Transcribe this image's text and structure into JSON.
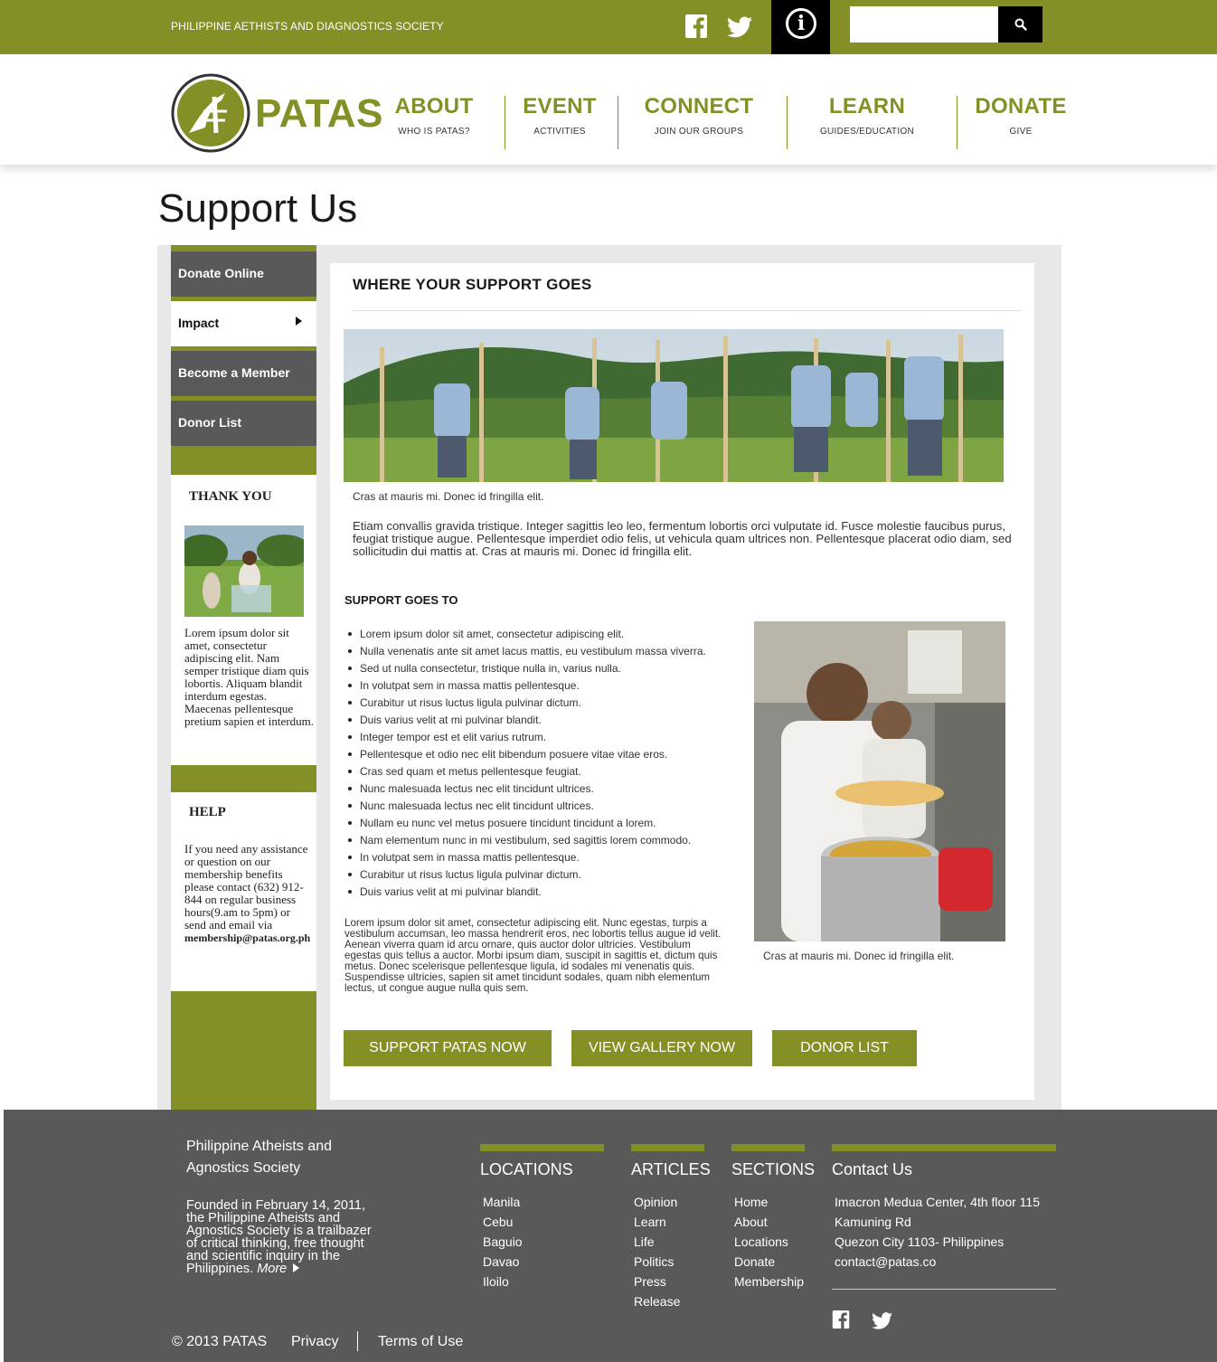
{
  "topbar": {
    "org_name": "PHILIPPINE AETHISTS AND DIAGNOSTICS SOCIETY",
    "search_placeholder": "",
    "info_glyph": "i"
  },
  "logo": {
    "text": "PATAS"
  },
  "nav": [
    {
      "label": "ABOUT",
      "sub": "WHO IS PATAS?"
    },
    {
      "label": "EVENT",
      "sub": "ACTIVITIES"
    },
    {
      "label": "CONNECT",
      "sub": "JOIN OUR GROUPS"
    },
    {
      "label": "LEARN",
      "sub": "GUIDES/EDUCATION"
    },
    {
      "label": "DONATE",
      "sub": "GIVE"
    }
  ],
  "page_title": "Support Us",
  "sidebar": {
    "menu": [
      "Donate Online",
      "Impact",
      "Become a Member",
      "Donor List"
    ],
    "active_index": 1,
    "thank_you": {
      "heading": "THANK YOU",
      "text": "Lorem ipsum dolor sit amet, consectetur adipiscing elit. Nam semper tristique diam quis lobortis. Aliquam blandit interdum egestas. Maecenas pellentesque pretium sapien et interdum."
    },
    "help": {
      "heading": "HELP",
      "text": "If you need any assistance or question on our membership benefits please contact (632) 912-844 on regular business hours(9.am to 5pm) or send and email via",
      "email": "membership@patas.org.ph"
    }
  },
  "main": {
    "section_title": "WHERE YOUR SUPPORT GOES",
    "hero_caption": "Cras at mauris mi. Donec id fringilla elit.",
    "intro": "Etiam convallis gravida tristique. Integer sagittis leo leo, fermentum lobortis orci vulputate id. Fusce molestie faucibus purus, feugiat tristique augue. Pellentesque imperdiet odio felis, ut vehicula quam ultrices non. Pellentesque placerat odio diam, sed sollicitudin dui mattis at. Cras at mauris mi. Donec id fringilla elit.",
    "sub_title": "SUPPORT GOES TO",
    "bullets": [
      "Lorem ipsum dolor sit amet, consectetur adipiscing elit.",
      "Nulla venenatis ante sit amet lacus mattis, eu vestibulum massa viverra.",
      "Sed ut nulla consectetur, tristique nulla in, varius nulla.",
      "In volutpat sem in massa mattis pellentesque.",
      "Curabitur ut risus luctus ligula pulvinar dictum.",
      "Duis varius velit at mi pulvinar blandit.",
      "Integer tempor est et elit varius rutrum.",
      "Pellentesque et odio nec elit bibendum posuere vitae vitae eros.",
      "Cras sed quam et metus pellentesque feugiat.",
      "Nunc malesuada lectus nec elit tincidunt ultrices.",
      "Nunc malesuada lectus nec elit tincidunt ultrices.",
      "Nullam eu nunc vel metus posuere tincidunt tincidunt a lorem.",
      "Nam elementum nunc in mi vestibulum, sed sagittis lorem commodo.",
      "In volutpat sem in massa mattis pellentesque.",
      "Curabitur ut risus luctus ligula pulvinar dictum.",
      "Duis varius velit at mi pulvinar blandit."
    ],
    "body": "Lorem ipsum dolor sit amet, consectetur adipiscing elit. Nunc egestas, turpis a vestibulum accumsan, leo massa hendrerit eros, nec lobortis tellus augue id velit. Aenean viverra quam id arcu ornare, quis auctor dolor ultricies. Vestibulum egestas quis tellus a auctor. Morbi ipsum diam, suscipit in sagittis et, dictum quis metus. Donec scelerisque pellentesque ligula, id sodales mi venenatis quis. Suspendisse ultricies, sapien sit amet tincidunt sodales, quam nibh elementum lectus, ut congue augue nulla quis sem.",
    "kitchen_caption": "Cras at mauris mi. Donec id fringilla elit.",
    "buttons": [
      "SUPPORT PATAS NOW",
      "VIEW GALLERY NOW",
      "DONOR LIST"
    ]
  },
  "footer": {
    "org_line1": "Philippine Atheists and",
    "org_line2": "Agnostics Society",
    "about": "Founded in February 14, 2011, the Philippine Atheists and Agnostics Society is a trailbazer of critical thinking, free thought and scientific inquiry in the Philippines.",
    "more_label": "More",
    "locations": {
      "heading": "LOCATIONS",
      "items": [
        "Manila",
        "Cebu",
        "Baguio",
        "Davao",
        "Iloilo"
      ]
    },
    "articles": {
      "heading": "ARTICLES",
      "items": [
        "Opinion",
        "Learn",
        "Life",
        "Politics",
        "Press",
        "Release"
      ]
    },
    "sections": {
      "heading": "SECTIONS",
      "items": [
        "Home",
        "About",
        "Locations",
        "Donate",
        "Membership"
      ]
    },
    "contact": {
      "heading": "Contact Us",
      "lines": [
        "Imacron Medua Center, 4th floor 115",
        "Kamuning Rd",
        "Quezon City 1103- Philippines",
        "contact@patas.co"
      ]
    },
    "copyright": "© 2013 PATAS",
    "privacy": "Privacy",
    "terms": "Terms of Use"
  },
  "colors": {
    "brand_green": "#849026",
    "sidebar_gray": "#595959",
    "footer_gray": "#595959"
  }
}
